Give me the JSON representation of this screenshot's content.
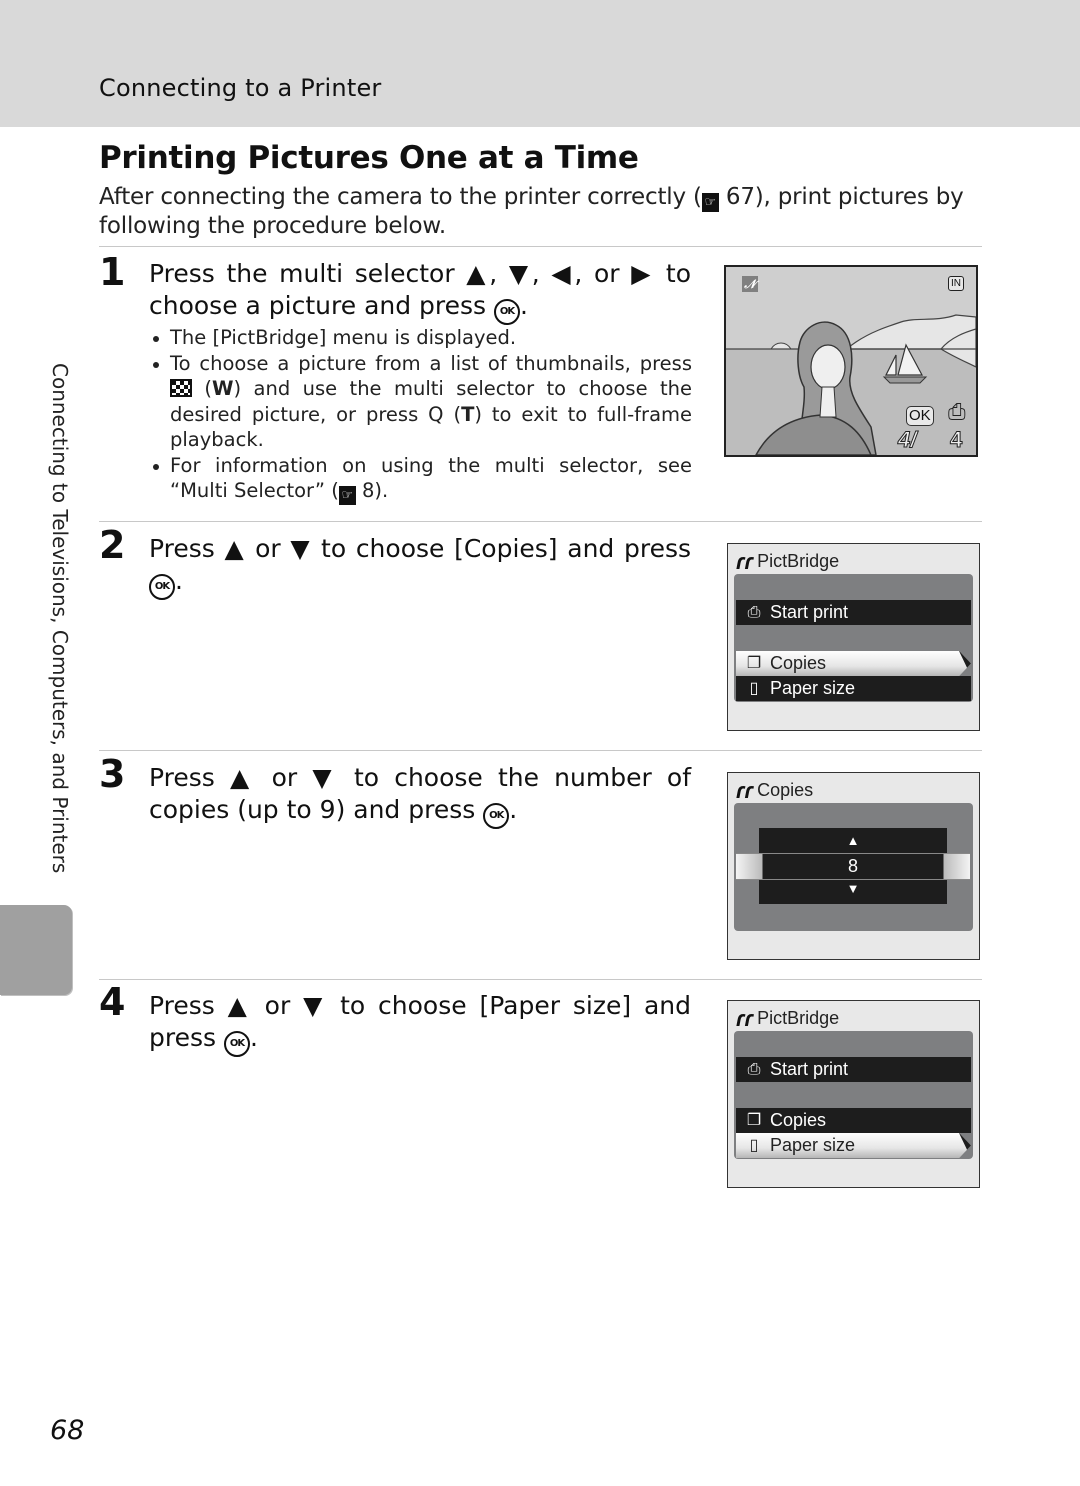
{
  "header": {
    "section": "Connecting to a Printer"
  },
  "page": {
    "title": "Printing Pictures One at a Time",
    "intro_before_ref": "After connecting the camera to the printer correctly (",
    "intro_ref_page": "67",
    "intro_after_ref": "), print pictures by following the procedure below.",
    "side_label": "Connecting to Televisions, Computers, and Printers",
    "page_number": "68"
  },
  "icons": {
    "reference": "reference-icon",
    "ok_button": "ok-button-icon",
    "thumbnail": "thumbnail-playback-icon",
    "zoom": "playback-zoom-icon",
    "pictbridge": "pictbridge-icon",
    "start_print": "printer-icon",
    "copies": "copies-icon",
    "paper_size": "paper-icon"
  },
  "steps": [
    {
      "number": "1",
      "text_a": "Press the multi selector ▲, ▼, ◀, or ▶ to choose a picture and press ",
      "text_b": ".",
      "bullets": [
        {
          "text": "The [PictBridge] menu is displayed."
        },
        {
          "text_a": "To choose a picture from a list of thumbnails, press ",
          "key_w": "W",
          "text_b": " and use the multi selector to choose the desired picture, or press ",
          "zoom_glyph": "Q",
          "key_t": "T",
          "text_c": " to exit to full-frame playback."
        },
        {
          "text_a": "For information on using the multi selector, see “Multi Selector” (",
          "ref_page": "8",
          "text_b": ")."
        }
      ],
      "screen": {
        "type": "photo",
        "memory_indicator": "IN",
        "ok_label": "OK",
        "frame_counter_current": "4/",
        "frame_counter_total": "4"
      }
    },
    {
      "number": "2",
      "text_a": "Press ▲ or ▼ to choose [Copies] and press ",
      "text_b": ".",
      "screen": {
        "title": "PictBridge",
        "items": [
          {
            "label": "Start print",
            "state": "normal"
          },
          {
            "label": "Copies",
            "state": "selected"
          },
          {
            "label": "Paper size",
            "state": "normal"
          }
        ]
      }
    },
    {
      "number": "3",
      "text_a": "Press ▲ or ▼ to choose the number of copies (up to 9) and press ",
      "text_b": ".",
      "screen": {
        "title": "Copies",
        "value": "8",
        "up_arrow": "▲",
        "down_arrow": "▼"
      }
    },
    {
      "number": "4",
      "text_a": "Press ▲ or ▼ to choose [Paper size] and press ",
      "text_b": ".",
      "screen": {
        "title": "PictBridge",
        "items": [
          {
            "label": "Start print",
            "state": "normal"
          },
          {
            "label": "Copies",
            "state": "normal"
          },
          {
            "label": "Paper size",
            "state": "selected"
          }
        ]
      }
    }
  ]
}
